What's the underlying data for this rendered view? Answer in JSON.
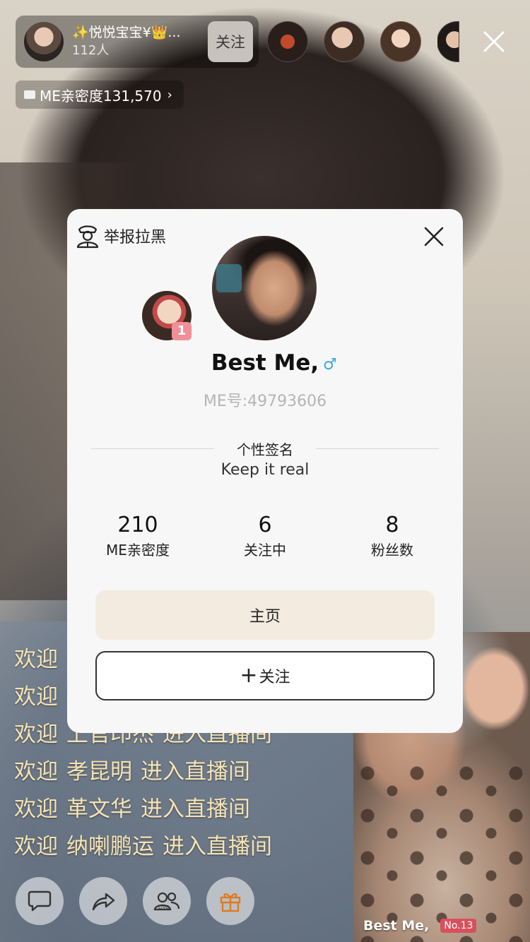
{
  "host": {
    "name": "✨悦悦宝宝¥👑...",
    "count": "112人",
    "follow_label": "关注"
  },
  "intimacy": {
    "label": "ME亲密度131,570",
    "chevron": "›"
  },
  "viewers": [
    "viewer-1",
    "viewer-2",
    "viewer-3",
    "viewer-4"
  ],
  "chat": [
    {
      "prefix": "欢迎",
      "name": "",
      "suffix": ""
    },
    {
      "prefix": "欢迎",
      "name": "",
      "suffix": ""
    },
    {
      "prefix": "欢迎",
      "name": "上官印杰",
      "suffix": "进入直播间"
    },
    {
      "prefix": "欢迎",
      "name": "孝昆明",
      "suffix": "进入直播间"
    },
    {
      "prefix": "欢迎",
      "name": "革文华",
      "suffix": "进入直播间"
    },
    {
      "prefix": "欢迎",
      "name": "纳喇鹏运",
      "suffix": "进入直播间"
    }
  ],
  "pk": {
    "name": "Best Me,",
    "rank": "No.13"
  },
  "card": {
    "report_label": "举报拉黑",
    "fan_rank": "1",
    "nickname": "Best Me,",
    "gender_symbol": "♂",
    "me_id": "ME号:49793606",
    "signature_title": "个性签名",
    "signature": "Keep it real",
    "stats": [
      {
        "value": "210",
        "label": "ME亲密度"
      },
      {
        "value": "6",
        "label": "关注中"
      },
      {
        "value": "8",
        "label": "粉丝数"
      }
    ],
    "home_label": "主页",
    "follow_plus": "+",
    "follow_label": "关注"
  },
  "toolbar": {
    "icons": [
      "chat-bubble-icon",
      "share-icon",
      "live-group-icon",
      "gift-icon"
    ],
    "live_text": "LIVE"
  },
  "colors": {
    "chat_text": "#f6e4b4",
    "gender": "#3aa9e0",
    "home_btn": "#f3ebdf",
    "rank_badge": "#d8505c",
    "fan_badge": "#f08f98"
  }
}
